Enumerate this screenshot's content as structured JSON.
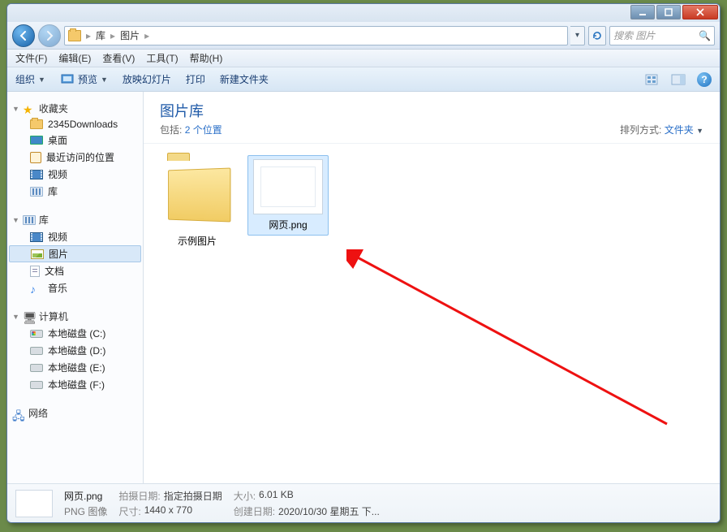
{
  "titlebar": {},
  "nav": {
    "path_root": "库",
    "path_current": "图片",
    "search_placeholder": "搜索 图片"
  },
  "menubar": {
    "file": "文件(F)",
    "edit": "编辑(E)",
    "view": "查看(V)",
    "tools": "工具(T)",
    "help": "帮助(H)"
  },
  "toolbar": {
    "organize": "组织",
    "preview": "预览",
    "slideshow": "放映幻灯片",
    "print": "打印",
    "newfolder": "新建文件夹"
  },
  "sidebar": {
    "favorites": {
      "label": "收藏夹",
      "items": [
        "2345Downloads",
        "桌面",
        "最近访问的位置",
        "视频",
        "库"
      ]
    },
    "libraries": {
      "label": "库",
      "items": [
        "视频",
        "图片",
        "文档",
        "音乐"
      ]
    },
    "computer": {
      "label": "计算机",
      "items": [
        "本地磁盘 (C:)",
        "本地磁盘 (D:)",
        "本地磁盘 (E:)",
        "本地磁盘 (F:)"
      ]
    },
    "network": {
      "label": "网络"
    }
  },
  "content": {
    "library_title": "图片库",
    "includes_label": "包括:",
    "includes_link": "2 个位置",
    "arrange_label": "排列方式:",
    "arrange_value": "文件夹",
    "items": [
      {
        "name": "示例图片",
        "type": "folder"
      },
      {
        "name": "网页.png",
        "type": "image",
        "selected": true
      }
    ]
  },
  "details": {
    "name": "网页.png",
    "type": "PNG 图像",
    "shotdate_label": "拍摄日期:",
    "shotdate_value": "指定拍摄日期",
    "dimensions_label": "尺寸:",
    "dimensions_value": "1440 x 770",
    "size_label": "大小:",
    "size_value": "6.01 KB",
    "created_label": "创建日期:",
    "created_value": "2020/10/30 星期五 下..."
  }
}
